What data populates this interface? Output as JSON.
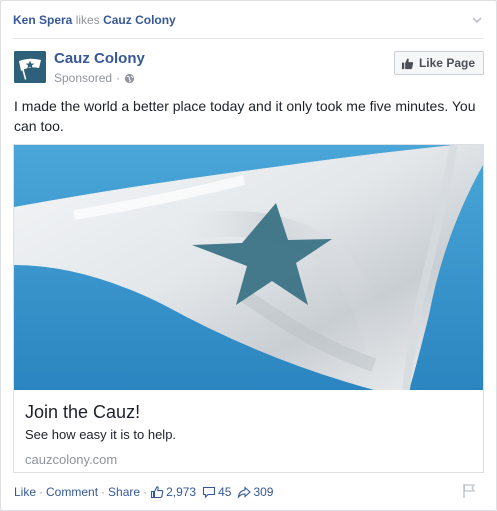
{
  "story": {
    "actor": "Ken Spera",
    "verb": "likes",
    "object": "Cauz Colony"
  },
  "page": {
    "name": "Cauz Colony",
    "sponsored": "Sponsored",
    "like_button": "Like Page"
  },
  "post": {
    "text": "I made the world a better place today and it only took me five minutes. You can too."
  },
  "attachment": {
    "title": "Join the Cauz!",
    "description": "See how easy it is to help.",
    "domain": "cauzcolony.com"
  },
  "actions": {
    "like": "Like",
    "comment": "Comment",
    "share": "Share",
    "likes_count": "2,973",
    "comments_count": "45",
    "shares_count": "309"
  },
  "colors": {
    "link": "#365899",
    "sky": "#3f9bd1",
    "star": "#3b7386"
  }
}
